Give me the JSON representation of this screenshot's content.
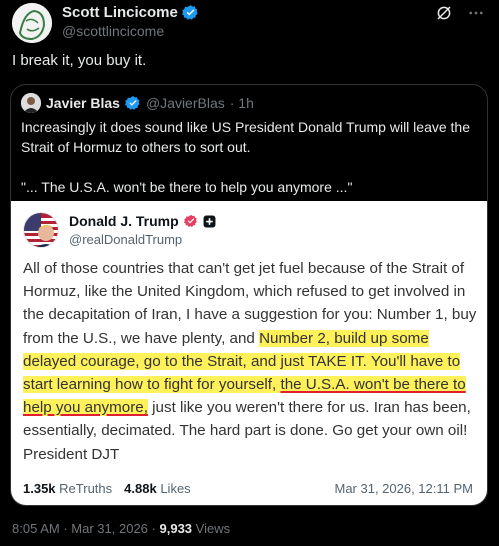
{
  "tweet": {
    "author_name": "Scott Lincicome",
    "author_handle": "@scottlincicome",
    "text": "I break it, you buy it.",
    "time": "8:05 AM",
    "date": "Mar 31, 2026",
    "views_count": "9,933",
    "views_label": "Views",
    "separator": "·"
  },
  "quote": {
    "author_name": "Javier Blas",
    "author_handle": "@JavierBlas",
    "time": "· 1h",
    "text_1": "Increasingly it does sound like US President Donald Trump will leave the Strait of Hormuz to others to sort out.",
    "text_2": "\"... The U.S.A. won't be there to help you anymore ...\""
  },
  "embed": {
    "author_name": "Donald J. Trump",
    "author_handle": "@realDonaldTrump",
    "body_1": "All of those countries that can't get jet fuel because of the Strait of Hormuz, like the United Kingdom, which refused to get involved in the decapitation of Iran, I have a suggestion for you: Number 1, buy from the U.S., we have plenty, and ",
    "body_hl1": "Number 2, build up some delayed courage, go to the Strait, and just TAKE IT. You'll have to start learning how to fight for yourself, ",
    "body_hl2": "the U.S.A. won't be there to help you anymore,",
    "body_3": " just like you weren't there for us. Iran has been, essentially, decimated. The hard part is done. Go get your own oil! President DJT",
    "retruths_count": "1.35k",
    "retruths_label": "ReTruths",
    "likes_count": "4.88k",
    "likes_label": "Likes",
    "date": "Mar 31, 2026, 12:11 PM"
  },
  "icons": [
    "verified-badge-icon",
    "grok-icon",
    "more-icon",
    "truth-badge-icon",
    "plus-badge-icon"
  ],
  "colors": {
    "verified": "#1d9bf0",
    "highlight": "#fff159",
    "underline": "#e0202d",
    "truth_badge": "#e33f63"
  }
}
